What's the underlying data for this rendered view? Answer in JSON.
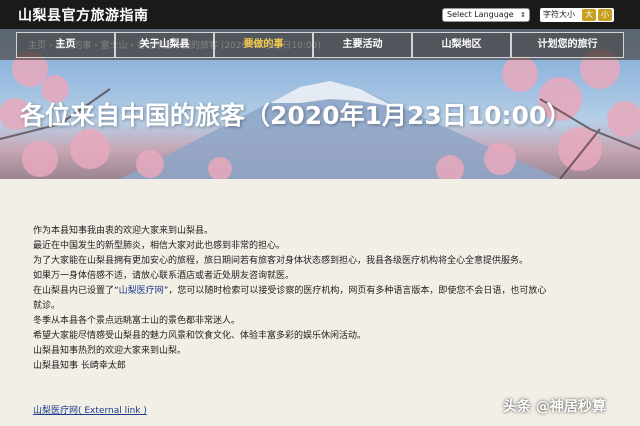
{
  "header": {
    "site_title": "山梨县官方旅游指南",
    "language_select": "Select Language",
    "font_size_label": "字符大小",
    "font_large": "大",
    "font_small": "小"
  },
  "breadcrumb": "主页 › 要做的事 › 富士山 › 各位来自中国的旅客 (2020年1月23日10:00)",
  "nav": [
    {
      "label": "主页"
    },
    {
      "label": "关于山梨县"
    },
    {
      "label": "要做的事"
    },
    {
      "label": "主要活动"
    },
    {
      "label": "山梨地区"
    },
    {
      "label": "计划您的旅行"
    }
  ],
  "hero": {
    "title": "各位来自中国的旅客（2020年1月23日10:00）"
  },
  "content": {
    "lines": [
      "作为本县知事我由衷的欢迎大家来到山梨县。",
      "最近在中国发生的新型肺炎，相信大家对此也感到非常的担心。",
      "为了大家能在山梨县拥有更加安心的旅程，旅日期间若有旅客对身体状态感到担心，我县各级医疗机构将全心全意提供服务。",
      "如果万一身体倍感不适，请放心联系酒店或者近处朋友咨询就医。"
    ],
    "line_med_before": "在山梨县内已设置了“",
    "line_med_link": "山梨医疗网",
    "line_med_after": "”，您可以随时检索可以接受诊察的医疗机构，网页有多种语言版本，即使您不会日语，也可放心",
    "line_med_cont": "就诊。",
    "lines2": [
      "冬季从本县各个景点远眺富士山的景色都非常迷人。",
      "希望大家能尽情感受山梨县的魅力风景和饮食文化、体验丰富多彩的娱乐休闲活动。",
      "山梨县知事热烈的欢迎大家来到山梨。",
      "山梨县知事 长崎幸太郎"
    ],
    "external_link": "山梨医疗网( External link )"
  },
  "watermark": "头条 @神居秒算"
}
